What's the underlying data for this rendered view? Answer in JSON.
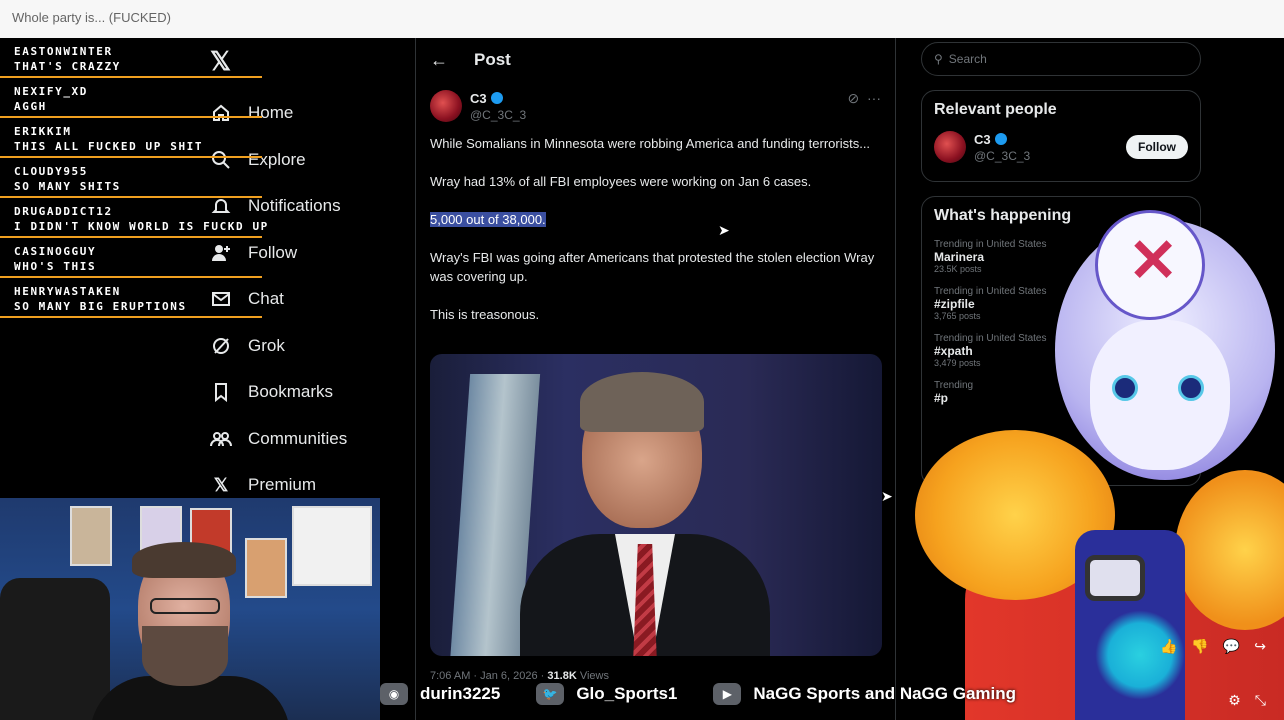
{
  "window": {
    "title": "Whole party is... (FUCKED)"
  },
  "x_nav": {
    "items": [
      {
        "label": "Home",
        "icon": "home-icon"
      },
      {
        "label": "Explore",
        "icon": "search-icon"
      },
      {
        "label": "Notifications",
        "icon": "bell-icon"
      },
      {
        "label": "Follow",
        "icon": "add-user-icon"
      },
      {
        "label": "Chat",
        "icon": "mail-icon"
      },
      {
        "label": "Grok",
        "icon": "grok-icon"
      },
      {
        "label": "Bookmarks",
        "icon": "bookmark-icon"
      },
      {
        "label": "Communities",
        "icon": "communities-icon"
      },
      {
        "label": "Premium",
        "icon": "x-icon"
      }
    ]
  },
  "chat": [
    {
      "user": "EASTONWINTER",
      "text": "THAT'S CRAZZY"
    },
    {
      "user": "NEXIFY_XD",
      "text": "AGGH"
    },
    {
      "user": "ERIKKIM",
      "text": "THIS ALL FUCKED UP SHIT"
    },
    {
      "user": "CLOUDY955",
      "text": "SO MANY SHITS"
    },
    {
      "user": "DRUGADDICT12",
      "text": "I DIDN'T KNOW WORLD IS FUCKD UP"
    },
    {
      "user": "CASINOGGUY",
      "text": "WHO'S THIS"
    },
    {
      "user": "HENRYWASTAKEN",
      "text": "SO MANY BIG ERUPTIONS"
    }
  ],
  "post": {
    "header_title": "Post",
    "author_name": "C3",
    "author_handle": "@C_3C_3",
    "paragraphs": [
      "While Somalians in Minnesota were robbing America and funding terrorists...",
      "Wray had 13% of all FBI employees were working on Jan 6 cases.",
      "5,000 out of 38,000.",
      "Wray's FBI was going after Americans that protested the stolen election Wray was covering up.",
      "This is treasonous."
    ],
    "meta_time": "7:06 AM · Jan 6, 2026 · ",
    "meta_views": "31.8K",
    "meta_views_label": " Views"
  },
  "right": {
    "search_placeholder": "Search",
    "relevant_title": "Relevant people",
    "relevant_name": "C3",
    "relevant_handle": "@C_3C_3",
    "follow_label": "Follow",
    "happening_title": "What's happening",
    "trends": [
      {
        "ctx": "Trending in United States",
        "title": "Marinera",
        "count": "23.5K posts"
      },
      {
        "ctx": "Trending in United States",
        "title": "#zipfile",
        "count": "3,765 posts"
      },
      {
        "ctx": "Trending in United States",
        "title": "#xpath",
        "count": "3,479 posts"
      },
      {
        "ctx": "Trending",
        "title": "#p",
        "count": ""
      }
    ]
  },
  "ticker": [
    {
      "logo": "discord-icon",
      "name": "durin3225"
    },
    {
      "logo": "twitter-icon",
      "name": "Glo_Sports1"
    },
    {
      "logo": "youtube-icon",
      "name": "NaGG Sports and NaGG Gaming"
    }
  ],
  "colors": {
    "accent": "#1d9bf0",
    "chat_line": "#f0a020",
    "highlight": "#3b4fa0"
  }
}
